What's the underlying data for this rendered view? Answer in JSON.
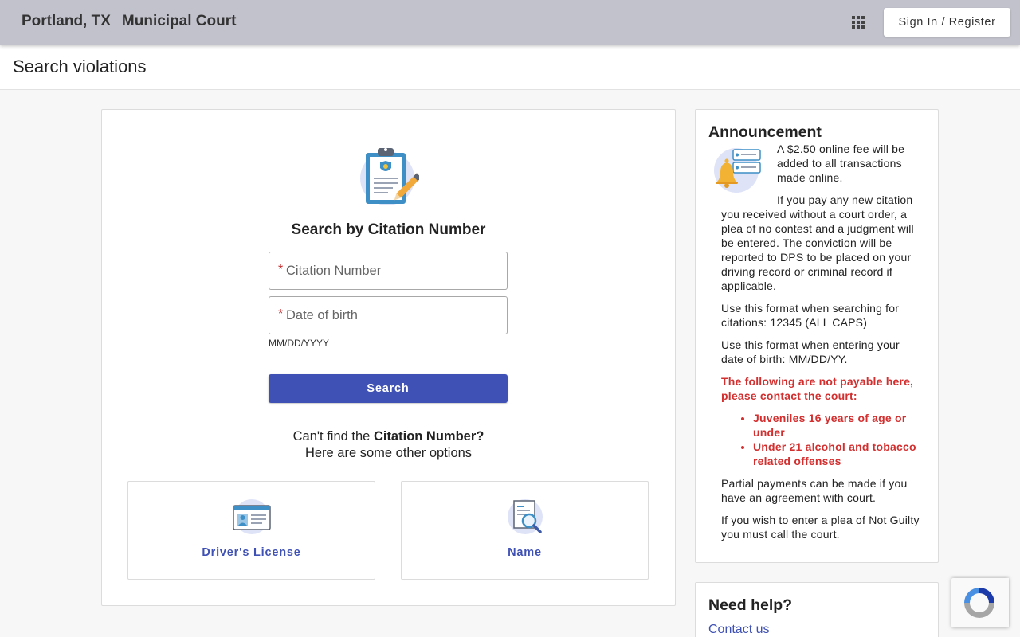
{
  "header": {
    "city": "Portland, TX",
    "court": "Municipal Court",
    "apps_icon": "apps-grid-icon",
    "signin_label": "Sign In / Register"
  },
  "page": {
    "title": "Search violations"
  },
  "search": {
    "heading": "Search by Citation Number",
    "citation_placeholder": "Citation Number",
    "dob_placeholder": "Date of birth",
    "required_mark": "*",
    "dob_hint": "MM/DD/YYYY",
    "button_label": "Search",
    "cant_find_prefix": "Can't find the ",
    "cant_find_bold": "Citation Number?",
    "other_options": "Here are some other options"
  },
  "options": [
    {
      "label": "Driver's License",
      "icon": "id-card-icon"
    },
    {
      "label": "Name",
      "icon": "document-search-icon"
    }
  ],
  "announcement": {
    "title": "Announcement",
    "p1": "A $2.50 online fee will be added to all transactions made online.",
    "p2": "If you pay any new citation you received without a court order, a plea of no contest and a judgment will be entered. The conviction will be reported to DPS to be placed on your driving record or criminal record if applicable.",
    "p3": "Use this format when searching for citations:  12345 (ALL CAPS)",
    "p4": "Use this format when entering your date of birth: MM/DD/YY.",
    "not_payable": "The following are not payable here, please contact the court:",
    "list": [
      "Juveniles 16 years of age or under",
      "Under 21 alcohol and tobacco related offenses"
    ],
    "p5": "Partial payments can be made if you have an agreement with court.",
    "p6": "If you wish to enter a plea of Not Guilty you must call the court."
  },
  "help": {
    "title": "Need help?",
    "link": "Contact us"
  },
  "colors": {
    "accent": "#3f51b5",
    "header_bg": "#c2c2cc",
    "warning_red": "#d32f2f"
  }
}
